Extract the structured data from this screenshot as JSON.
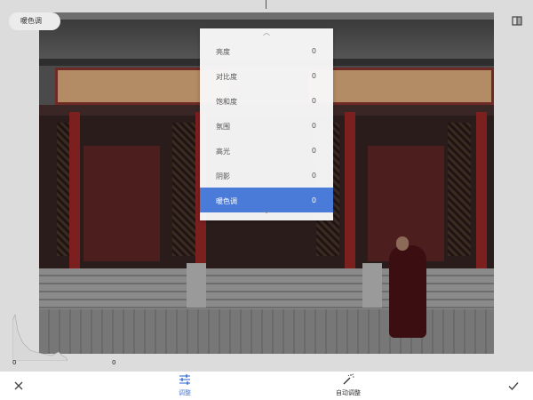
{
  "filter_chip": {
    "label": "暖色调"
  },
  "adjust_menu": {
    "items": [
      {
        "label": "亮度",
        "value": "0"
      },
      {
        "label": "对比度",
        "value": "0"
      },
      {
        "label": "饱和度",
        "value": "0"
      },
      {
        "label": "氛围",
        "value": "0"
      },
      {
        "label": "高光",
        "value": "0"
      },
      {
        "label": "阴影",
        "value": "0"
      },
      {
        "label": "暖色调",
        "value": "0"
      }
    ],
    "selected_index": 6,
    "selected_color": "#4a7bd8"
  },
  "histogram": {
    "min_label": "0",
    "max_label": "0"
  },
  "toolbar": {
    "adjust_label": "调整",
    "auto_adjust_label": "自动调整",
    "active_color": "#4a7bd8",
    "icons": {
      "cancel": "close-icon",
      "adjust": "sliders-icon",
      "auto": "magic-wand-icon",
      "apply": "checkmark-icon"
    }
  },
  "icons": {
    "compare": "compare-icon"
  }
}
